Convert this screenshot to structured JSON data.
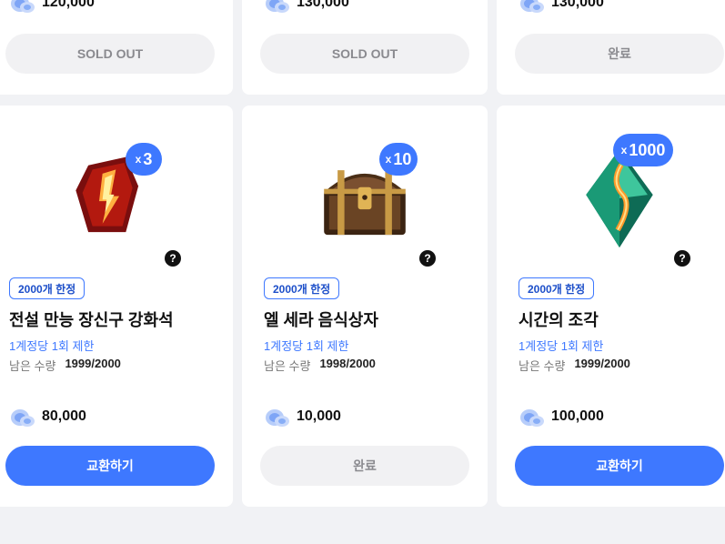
{
  "top_row": [
    {
      "price": "120,000",
      "button": "SOLD OUT",
      "button_state": "disabled"
    },
    {
      "price": "130,000",
      "button": "SOLD OUT",
      "button_state": "disabled"
    },
    {
      "price": "130,000",
      "button": "완료",
      "button_state": "disabled"
    }
  ],
  "items": [
    {
      "badge_x": "x",
      "badge_count": "3",
      "help_label": "?",
      "limit_tag": "2000개 한정",
      "name": "전설 만능 장신구 강화석",
      "per_account": "1계정당 1회 제한",
      "remain_label": "남은 수량",
      "remain_value": "1999/2000",
      "price": "80,000",
      "button": "교환하기",
      "button_state": "active",
      "image_icon": "legendary-enhancement-stone-icon"
    },
    {
      "badge_x": "x",
      "badge_count": "10",
      "help_label": "?",
      "limit_tag": "2000개 한정",
      "name": "엘 세라 음식상자",
      "per_account": "1계정당 1회 제한",
      "remain_label": "남은 수량",
      "remain_value": "1998/2000",
      "price": "10,000",
      "button": "완료",
      "button_state": "disabled",
      "image_icon": "treasure-chest-icon"
    },
    {
      "badge_x": "x",
      "badge_count": "1000",
      "help_label": "?",
      "limit_tag": "2000개 한정",
      "name": "시간의 조각",
      "per_account": "1계정당 1회 제한",
      "remain_label": "남은 수량",
      "remain_value": "1999/2000",
      "price": "100,000",
      "button": "교환하기",
      "button_state": "active",
      "image_icon": "time-crystal-icon"
    }
  ],
  "colors": {
    "accent": "#3e78ff",
    "background": "#f1f2f5",
    "disabled_button": "#f1f1f3"
  }
}
